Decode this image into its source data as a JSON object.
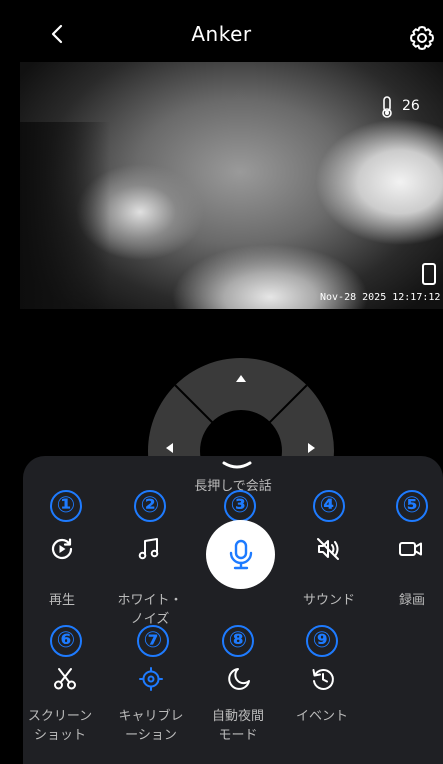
{
  "header": {
    "title": "Anker",
    "back_icon": "chevron-left-icon",
    "settings_icon": "gear-icon"
  },
  "video": {
    "temperature": "26",
    "timestamp": "Nov-28 2025  12:17:12"
  },
  "controls": {
    "talk_hint": "長押しで会話",
    "accent_color": "#1e7bff",
    "tools": [
      {
        "number": "①",
        "label": "再生",
        "icon": "replay-icon"
      },
      {
        "number": "②",
        "label": "ホワイト・\nノイズ",
        "icon": "music-note-icon"
      },
      {
        "number": "③",
        "label": "",
        "icon": "microphone-icon"
      },
      {
        "number": "④",
        "label": "サウンド",
        "icon": "speaker-muted-icon"
      },
      {
        "number": "⑤",
        "label": "録画",
        "icon": "video-camera-icon"
      },
      {
        "number": "⑥",
        "label": "スクリーン\nショット",
        "icon": "scissors-icon"
      },
      {
        "number": "⑦",
        "label": "キャリブレ\nーション",
        "icon": "calibration-icon"
      },
      {
        "number": "⑧",
        "label": "自動夜間\nモード",
        "icon": "moon-icon"
      },
      {
        "number": "⑨",
        "label": "イベント",
        "icon": "history-icon"
      }
    ]
  }
}
